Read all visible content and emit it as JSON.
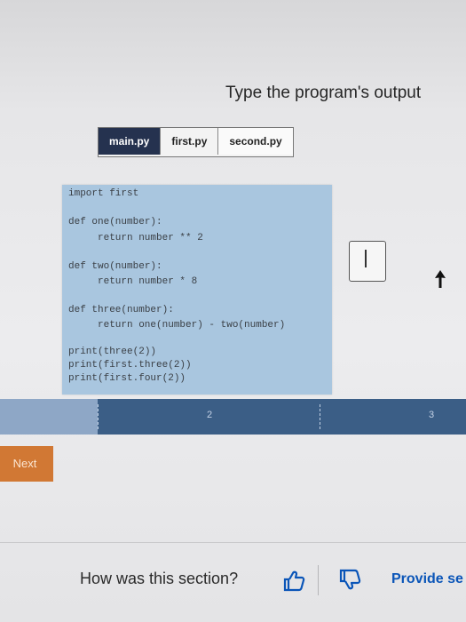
{
  "instruction": "Type the program's output",
  "tabs": [
    {
      "label": "main.py",
      "active": true
    },
    {
      "label": "first.py",
      "active": false
    },
    {
      "label": "second.py",
      "active": false
    }
  ],
  "code": [
    "import first",
    "def one(number):",
    "return number ** 2",
    "def two(number):",
    "return number * 8",
    "def three(number):",
    "return one(number) - two(number)",
    "print(three(2))",
    "print(first.three(2))",
    "print(first.four(2))"
  ],
  "answer": {
    "value": ""
  },
  "progress": {
    "labels": [
      "2",
      "3"
    ],
    "completed_fraction": 0.21
  },
  "next_label": "Next",
  "feedback": {
    "question": "How was this section?",
    "provide_label": "Provide se"
  },
  "colors": {
    "tab_active": "#25324f",
    "code_bg": "#a9c6df",
    "progress_bar": "#3b5e86",
    "next_button": "#d17834",
    "link": "#0a55b8"
  }
}
